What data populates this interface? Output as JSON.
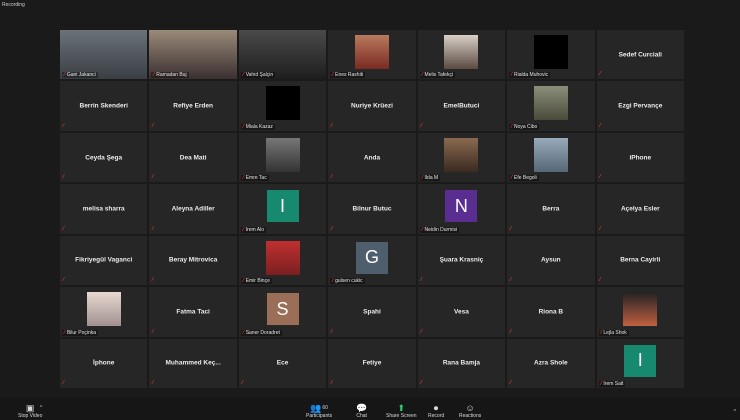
{
  "status": {
    "recording": "Recording"
  },
  "colors": {
    "avatar_green": "#16896e",
    "avatar_purple": "#5a2d91",
    "avatar_slate": "#4f5e6d",
    "avatar_brown": "#9b6e57",
    "active_border": "#c8d85a",
    "muted": "#ff3b3b"
  },
  "tiles": [
    {
      "name": "Gani Jakanci",
      "kind": "video",
      "active": true
    },
    {
      "name": "Ramadan Buj",
      "kind": "video"
    },
    {
      "name": "Vahid Şalçin",
      "kind": "video"
    },
    {
      "name": "Enes Rashiti",
      "kind": "photo"
    },
    {
      "name": "Melis Tafekçi",
      "kind": "photo"
    },
    {
      "name": "Rialda Muhovic",
      "kind": "photo"
    },
    {
      "name": "Sedef Curciali",
      "kind": "text"
    },
    {
      "name": "Berrin Skenderi",
      "kind": "text"
    },
    {
      "name": "Refiye Erden",
      "kind": "text"
    },
    {
      "name": "Miala Kazaz",
      "kind": "photo"
    },
    {
      "name": "Nuriye Krüezi",
      "kind": "text"
    },
    {
      "name": "EmelButuci",
      "kind": "text"
    },
    {
      "name": "Noya Cibo",
      "kind": "photo"
    },
    {
      "name": "Ezgi Pervançe",
      "kind": "text"
    },
    {
      "name": "Ceyda Şega",
      "kind": "text"
    },
    {
      "name": "Dea Mati",
      "kind": "text"
    },
    {
      "name": "Emre Tac",
      "kind": "photo"
    },
    {
      "name": "Anda",
      "kind": "text"
    },
    {
      "name": "Ilda M",
      "kind": "photo"
    },
    {
      "name": "Efe Begoli",
      "kind": "photo"
    },
    {
      "name": "iPhone",
      "kind": "text"
    },
    {
      "name": "melisa sharra",
      "kind": "text"
    },
    {
      "name": "Aleyna Adiller",
      "kind": "text"
    },
    {
      "name": "Irem Alo",
      "kind": "avatar",
      "letter": "I",
      "color": "avatar_green"
    },
    {
      "name": "Bilnur Butuc",
      "kind": "text"
    },
    {
      "name": "Neidin Durmisi",
      "kind": "avatar",
      "letter": "N",
      "color": "avatar_purple"
    },
    {
      "name": "Berra",
      "kind": "text"
    },
    {
      "name": "Açelya Esler",
      "kind": "text"
    },
    {
      "name": "Fikriyegül Vaganci",
      "kind": "text"
    },
    {
      "name": "Beray Mitrovica",
      "kind": "text"
    },
    {
      "name": "Emir Binçe",
      "kind": "photo"
    },
    {
      "name": "gulsen cukic",
      "kind": "avatar",
      "letter": "G",
      "color": "avatar_slate"
    },
    {
      "name": "Şuara Krasniç",
      "kind": "text"
    },
    {
      "name": "Aysun",
      "kind": "text"
    },
    {
      "name": "Berna Cayirli",
      "kind": "text"
    },
    {
      "name": "Bilur Poçinka",
      "kind": "photo"
    },
    {
      "name": "Fatma Taci",
      "kind": "text"
    },
    {
      "name": "Saner Doradret",
      "kind": "avatar",
      "letter": "S",
      "color": "avatar_brown"
    },
    {
      "name": "Spahi",
      "kind": "text"
    },
    {
      "name": "Vesa",
      "kind": "text"
    },
    {
      "name": "Riona B",
      "kind": "text"
    },
    {
      "name": "Lejla Shok",
      "kind": "photo"
    },
    {
      "name": "İphone",
      "kind": "text"
    },
    {
      "name": "Muhammed  Keç...",
      "kind": "text"
    },
    {
      "name": "Ece",
      "kind": "text"
    },
    {
      "name": "Fetiye",
      "kind": "text"
    },
    {
      "name": "Rana Bamja",
      "kind": "text"
    },
    {
      "name": "Azra  Shole",
      "kind": "text"
    },
    {
      "name": "Irem Sait",
      "kind": "avatar",
      "letter": "I",
      "color": "avatar_green"
    }
  ],
  "toolbar": {
    "stop_video": "Stop Video",
    "participants": "Participants",
    "participants_count": "60",
    "chat": "Chat",
    "share_screen": "Share Screen",
    "record": "Record",
    "reactions": "Reactions",
    "more_glyph": "^"
  }
}
